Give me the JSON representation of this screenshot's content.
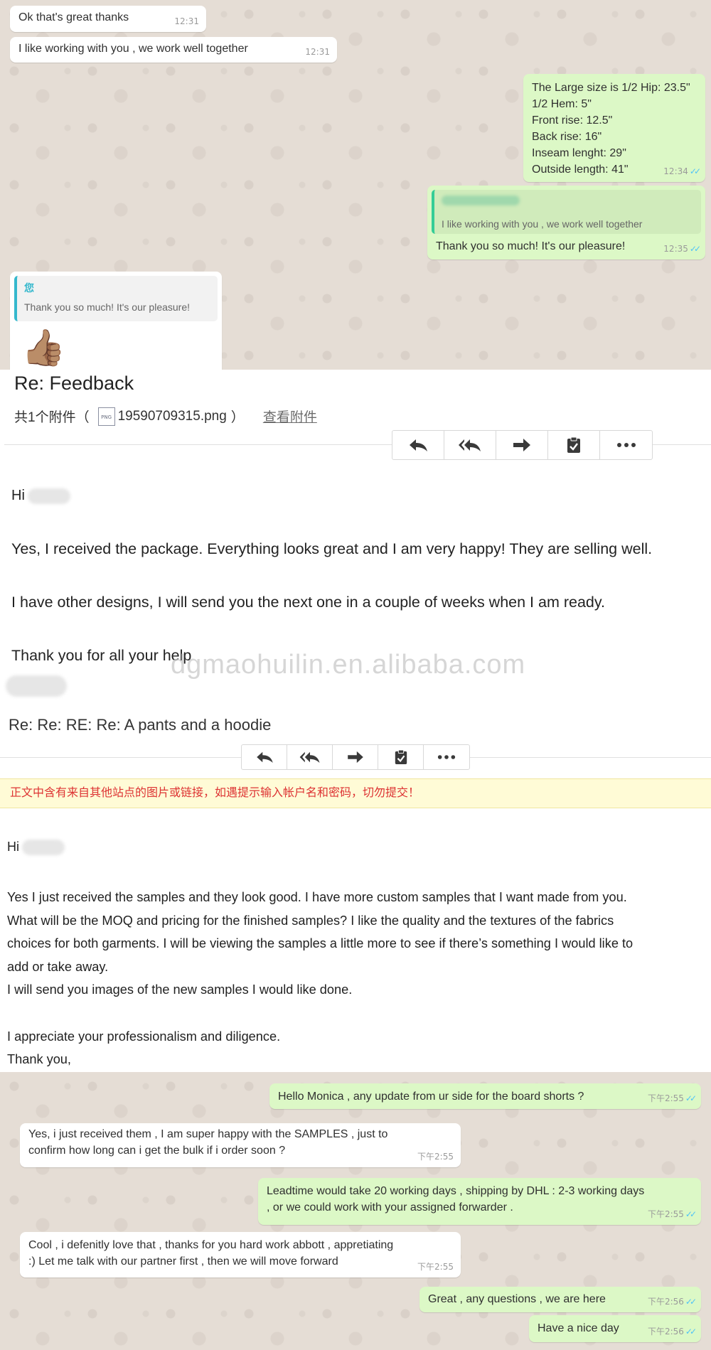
{
  "chat1": {
    "messages": [
      {
        "text": "Ok that's great thanks",
        "time": "12:31"
      },
      {
        "text": "I like working with you , we work well together",
        "time": "12:31"
      },
      {
        "text": "The Large size is 1/2 Hip: 23.5\"\n1/2 Hem: 5\"\nFront rise: 12.5\"\nBack rise: 16\"\nInseam lenght: 29\"\nOutside length: 41\"",
        "time": "12:34"
      },
      {
        "quote": "I like working with you , we work well together",
        "text": "Thank you so much! It's our pleasure!",
        "time": "12:35"
      },
      {
        "quote_author": "您",
        "quote": "Thank you so much! It's our pleasure!",
        "emoji": "👍🏽"
      }
    ]
  },
  "email1": {
    "subject": "Re: Feedback",
    "attachment_prefix": "共1个附件（",
    "file_icon": "PNG",
    "attachment_name": "19590709315.png",
    "attachment_suffix": "）",
    "view_attachment": "查看附件",
    "greeting": "Hi",
    "para1": "Yes, I received the package. Everything looks great and I am very happy! They are selling well.",
    "para2": "I have other designs, I will send you the next one in a couple of weeks when I am ready.",
    "para3": "Thank you for all your help",
    "toolbar": [
      "reply-icon",
      "reply-all-icon",
      "forward-icon",
      "clipboard-icon",
      "more-icon"
    ]
  },
  "watermark": "dgmaohuilin.en.alibaba.com",
  "email2": {
    "subject": "Re: Re: RE: Re: A pants and a hoodie",
    "warning": "正文中含有来自其他站点的图片或链接，如遇提示输入帐户名和密码，切勿提交！",
    "greeting": "Hi",
    "body": "Yes I just received the samples and they look good. I have more  custom samples that I want made from you.\nWhat will be the MOQ and pricing for the finished samples? I like the quality and the textures of the fabrics\nchoices for both garments. I will be viewing the samples a little more to see if there’s something I would like to\nadd or take away.\nI will send you images of the new samples I would like done.\n\nI appreciate your professionalism and diligence.\nThank you,"
  },
  "chat2": {
    "messages": [
      {
        "text": "Hello Monica , any update from ur side for the board shorts ?",
        "time": "下午2:55"
      },
      {
        "text": "Yes, i just received them , I am super happy with the SAMPLES , just to\nconfirm how long can i get the bulk if i order soon ?",
        "time": "下午2:55"
      },
      {
        "text": "Leadtime would take 20 working days , shipping by DHL : 2-3 working days\n, or we could work with your assigned forwarder .",
        "time": "下午2:55"
      },
      {
        "text": "Cool , i defenitly love that  , thanks for you hard work abbott , appretiating\n:) Let me talk with our partner first , then we will move forward",
        "time": "下午2:55"
      },
      {
        "text": "Great , any questions , we are here",
        "time": "下午2:56"
      },
      {
        "text": "Have a nice day",
        "time": "下午2:56"
      }
    ]
  },
  "colors": {
    "incoming": "#ffffff",
    "outgoing": "#dcf8c6",
    "chat_bg": "#e5ddd5",
    "warning_text": "#dd3333",
    "read_ticks": "#4fc3f7"
  }
}
